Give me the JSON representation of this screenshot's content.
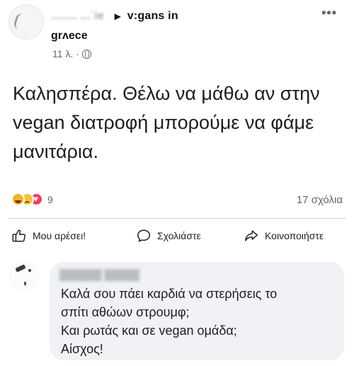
{
  "post": {
    "header_obscured": "........  ...΄ie",
    "header_visible": "v:gans in",
    "group_line": "grʌece",
    "timestamp": "11 λ. ·",
    "text": "Καλησπέρα. Θέλω να μάθω αν στην vegan διατροφή μπορούμε να φάμε μανιτάρια.",
    "more_label": "•••"
  },
  "stats": {
    "reactions_count": "9",
    "comments_count": "17 σχόλια"
  },
  "actions": {
    "like": "Μου αρέσει!",
    "comment": "Σχολιάστε",
    "share": "Κοινοποιήστε"
  },
  "comment": {
    "author_obscured": "██████ █████",
    "text": "Καλά σου πάει καρδιά να στερήσεις το\nσπίτι αθώων στρουμφ;\nΚαι ρωτάς και σε vegan ομάδα;\nΑίσχος!"
  },
  "colors": {
    "text": "#1c1e21",
    "secondary": "#606770",
    "comment_bubble": "#f0f2f5",
    "love": "#f33e58",
    "haha": "#f7b125"
  },
  "icons": [
    "globe-icon",
    "more-icon",
    "haha-icon",
    "sad-icon",
    "love-icon",
    "thumbs-up-icon",
    "comment-icon",
    "share-icon"
  ]
}
